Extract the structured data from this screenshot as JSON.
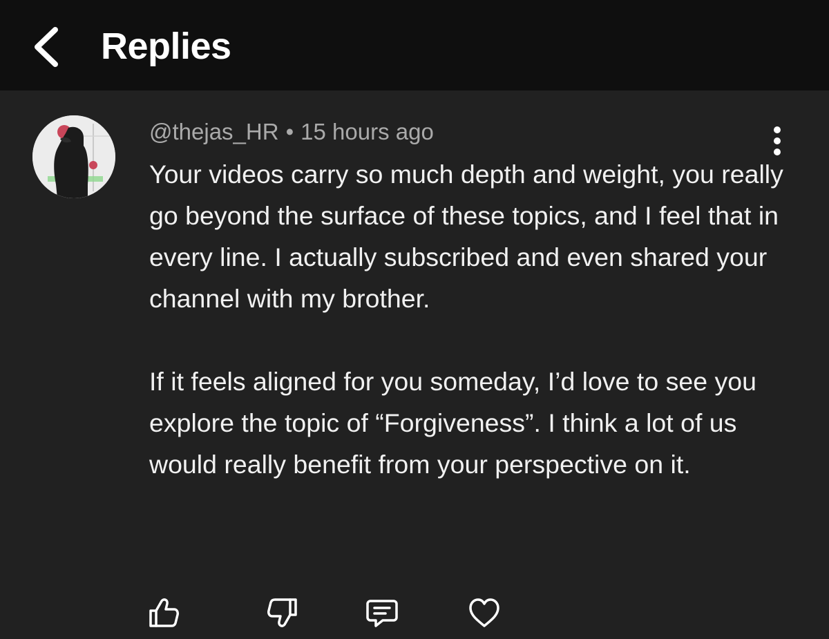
{
  "header": {
    "title": "Replies",
    "back_icon": "chevron-left-icon"
  },
  "comment": {
    "author": "@thejas_HR",
    "separator": "•",
    "timestamp": "15 hours ago",
    "paragraphs": [
      "Your videos carry so much depth and weight, you really go beyond the surface of these topics, and I feel that in every line. I actually subscribed and even shared your channel with my brother.",
      "If it feels aligned for you someday, I’d love to see you explore the topic of “Forgiveness”.  I think a lot of us would really benefit from your perspective on it."
    ]
  },
  "actions": [
    "thumbs-up-icon",
    "thumbs-down-icon",
    "reply-icon",
    "heart-icon"
  ],
  "colors": {
    "background": "#212121",
    "header_background": "#0f0f0f",
    "text": "#f1f1f1",
    "secondary_text": "#aaaaaa"
  }
}
